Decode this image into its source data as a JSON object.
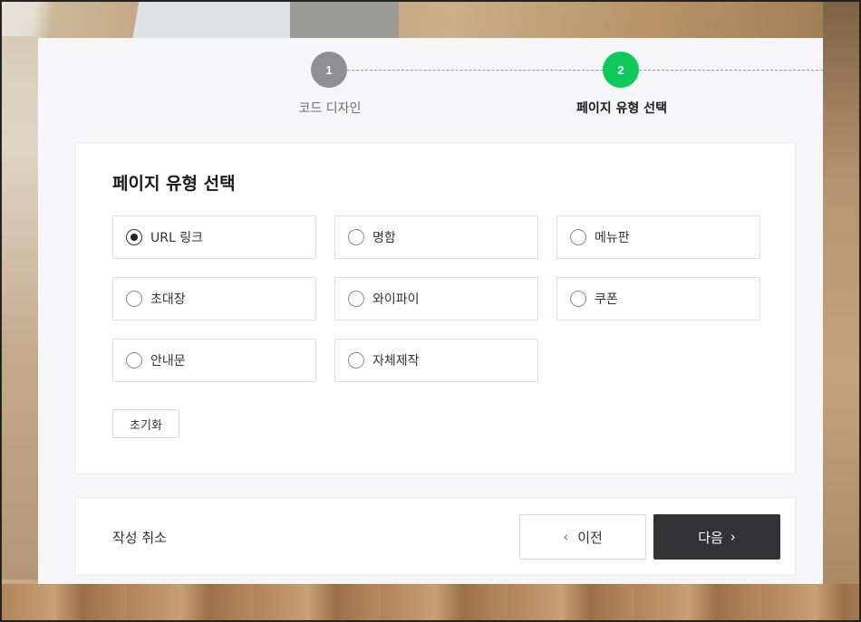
{
  "stepper": {
    "steps": [
      {
        "number": "1",
        "label": "코드 디자인",
        "state": "done"
      },
      {
        "number": "2",
        "label": "페이지 유형 선택",
        "state": "active"
      }
    ],
    "colors": {
      "done": "#8e8e93",
      "active": "#0fc85c"
    }
  },
  "panel": {
    "title": "페이지 유형 선택",
    "options": [
      {
        "label": "URL 링크",
        "checked": true
      },
      {
        "label": "명함",
        "checked": false
      },
      {
        "label": "메뉴판",
        "checked": false
      },
      {
        "label": "초대장",
        "checked": false
      },
      {
        "label": "와이파이",
        "checked": false
      },
      {
        "label": "쿠폰",
        "checked": false
      },
      {
        "label": "안내문",
        "checked": false
      },
      {
        "label": "자체제작",
        "checked": false
      }
    ],
    "reset_label": "초기화"
  },
  "footer": {
    "cancel_label": "작성 취소",
    "prev_label": "이전",
    "next_label": "다음",
    "prev_icon": "chevron-left-icon",
    "next_icon": "chevron-right-icon"
  }
}
